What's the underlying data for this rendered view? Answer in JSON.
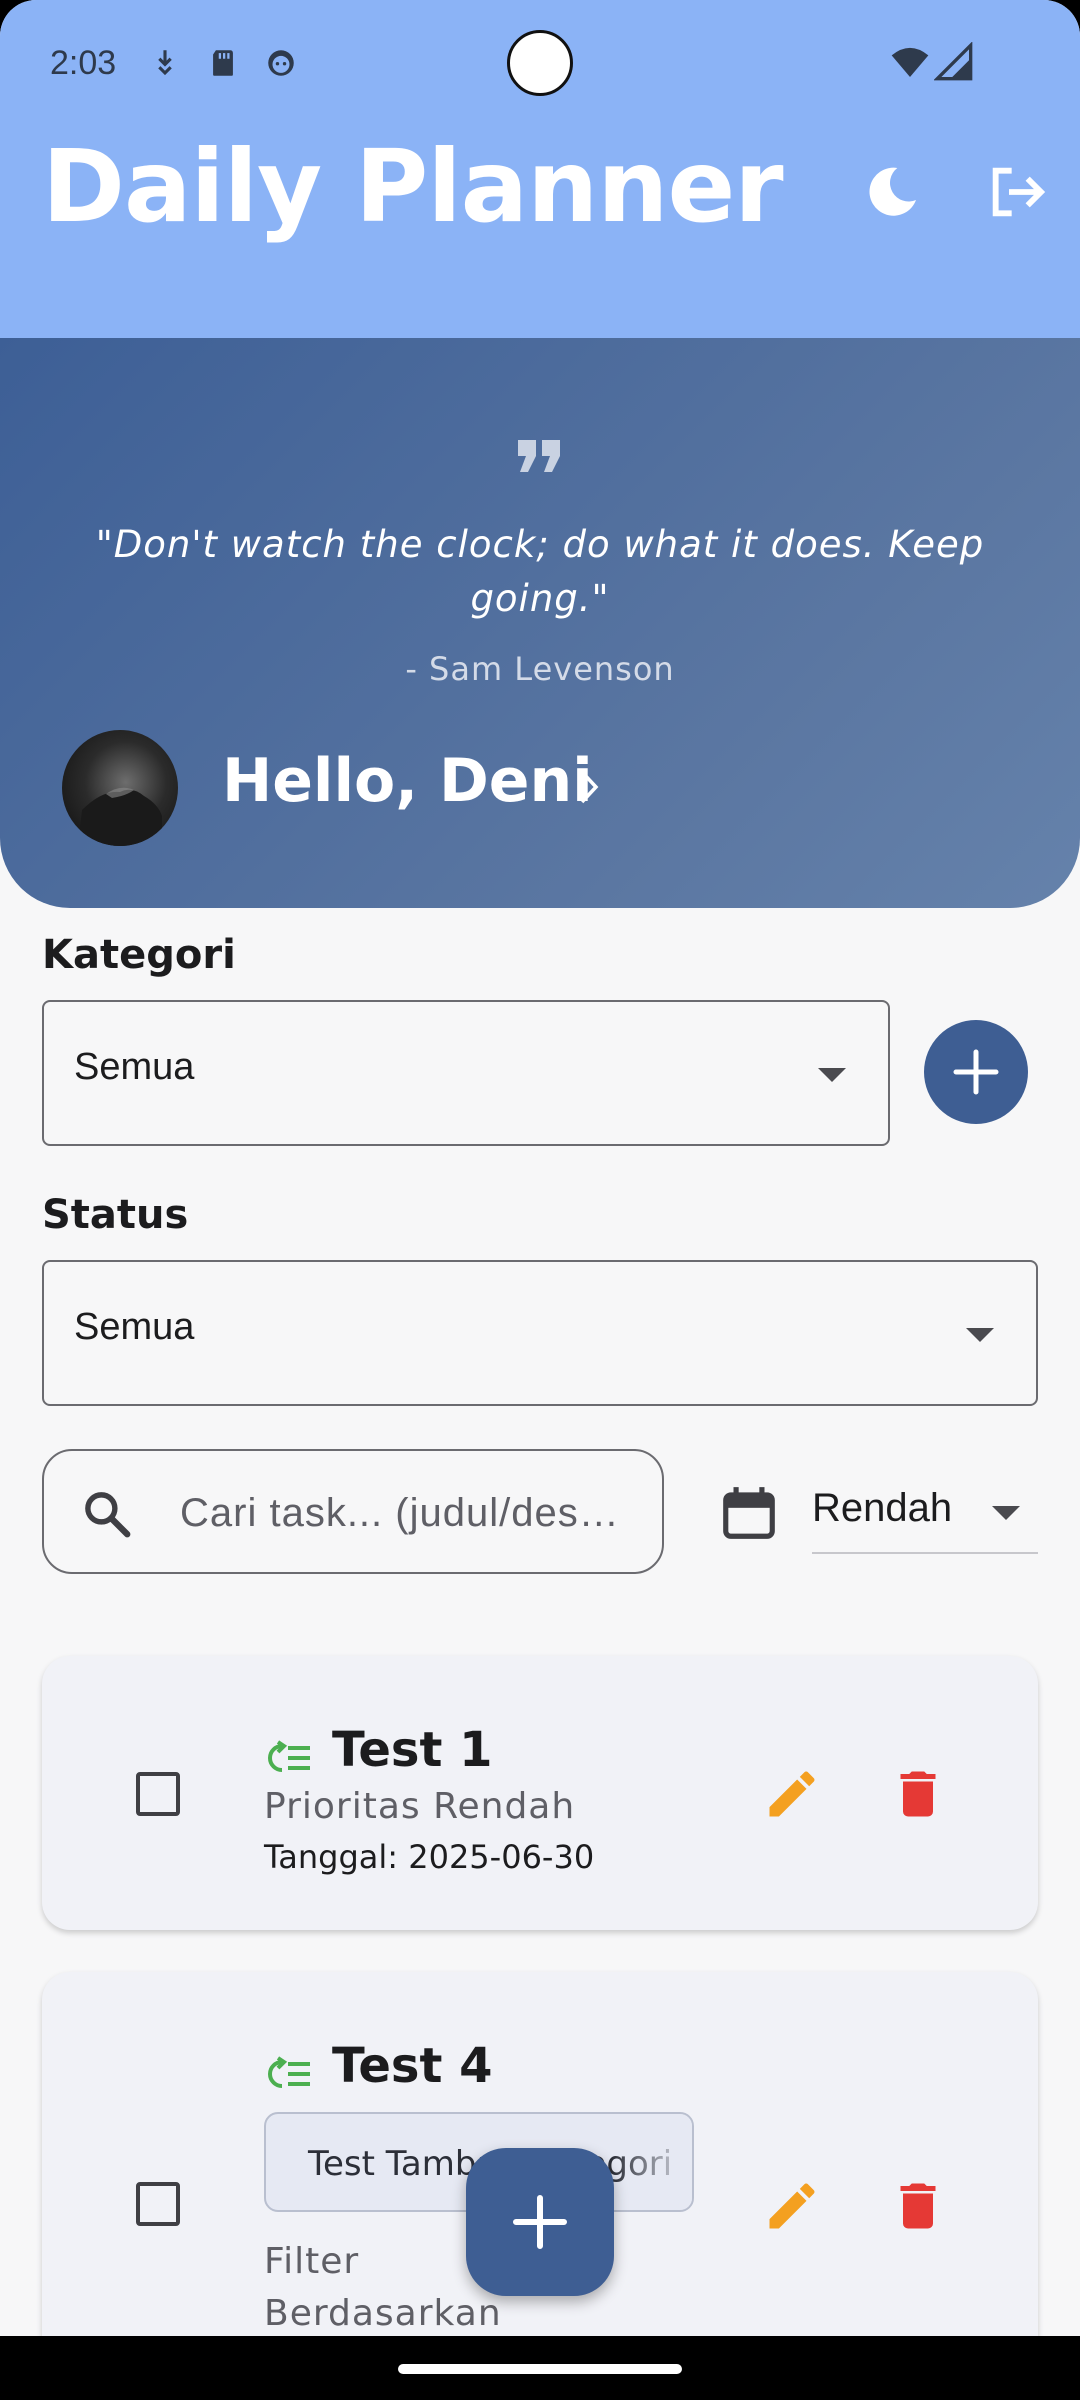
{
  "status_bar": {
    "time": "2:03"
  },
  "app_bar": {
    "title": "Daily Planner",
    "theme_icon": "moon-icon",
    "logout_icon": "logout-icon"
  },
  "hero": {
    "quote_icon": "quote-icon",
    "quote": "\"Don't watch the clock; do what it does. Keep going.\"",
    "author": "- Sam Levenson",
    "greeting": "Hello, Deni"
  },
  "filters": {
    "category_label": "Kategori",
    "category_value": "Semua",
    "status_label": "Status",
    "status_value": "Semua",
    "search_placeholder": "Cari task... (judul/deskripsi)",
    "priority_value": "Rendah"
  },
  "tasks": [
    {
      "title": "Test 1",
      "priority": "Prioritas Rendah",
      "date": "Tanggal: 2025-06-30"
    },
    {
      "title": "Test 4",
      "chip": "Test Tambah Kategori",
      "description": "Filter Berdasarkan Kategori"
    }
  ],
  "colors": {
    "app_bar": "#8bb3f6",
    "primary": "#3e5e93",
    "edit": "#f4a020",
    "delete": "#e53935",
    "task_icon": "#4caf50"
  }
}
